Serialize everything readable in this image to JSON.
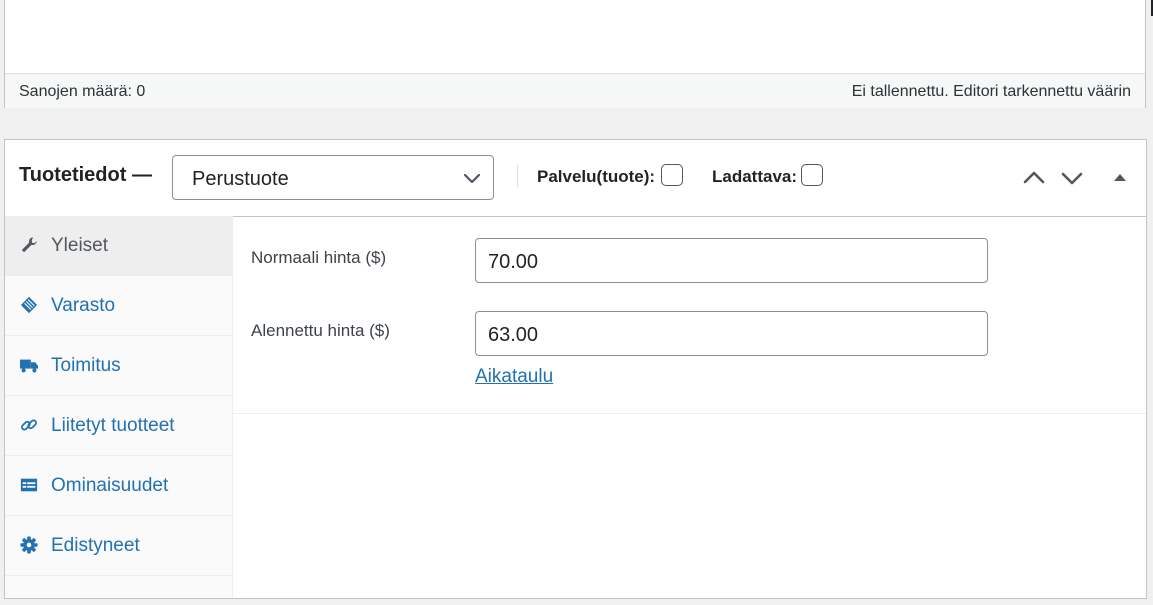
{
  "editor": {
    "word_count": "Sanojen määrä: 0",
    "save_status": "Ei tallennettu. Editori tarkennettu väärin"
  },
  "product_data": {
    "title": "Tuotetiedot —",
    "product_type": {
      "selected": "Perustuote"
    },
    "options": {
      "virtual_label": "Palvelu(tuote):",
      "downloadable_label": "Ladattava:"
    }
  },
  "tabs": [
    {
      "label": "Yleiset",
      "icon": "wrench-icon",
      "active": true
    },
    {
      "label": "Varasto",
      "icon": "tag-icon",
      "active": false
    },
    {
      "label": "Toimitus",
      "icon": "truck-icon",
      "active": false
    },
    {
      "label": "Liitetyt tuotteet",
      "icon": "link-icon",
      "active": false
    },
    {
      "label": "Ominaisuudet",
      "icon": "table-icon",
      "active": false
    },
    {
      "label": "Edistyneet",
      "icon": "gear-icon",
      "active": false
    }
  ],
  "general": {
    "regular_price_label": "Normaali hinta ($)",
    "regular_price_value": "70.00",
    "sale_price_label": "Alennettu hinta ($)",
    "sale_price_value": "63.00",
    "schedule_link": "Aikataulu"
  },
  "colors": {
    "link": "#2271b1",
    "border": "#c3c4c7",
    "background": "#f0f0f1"
  }
}
